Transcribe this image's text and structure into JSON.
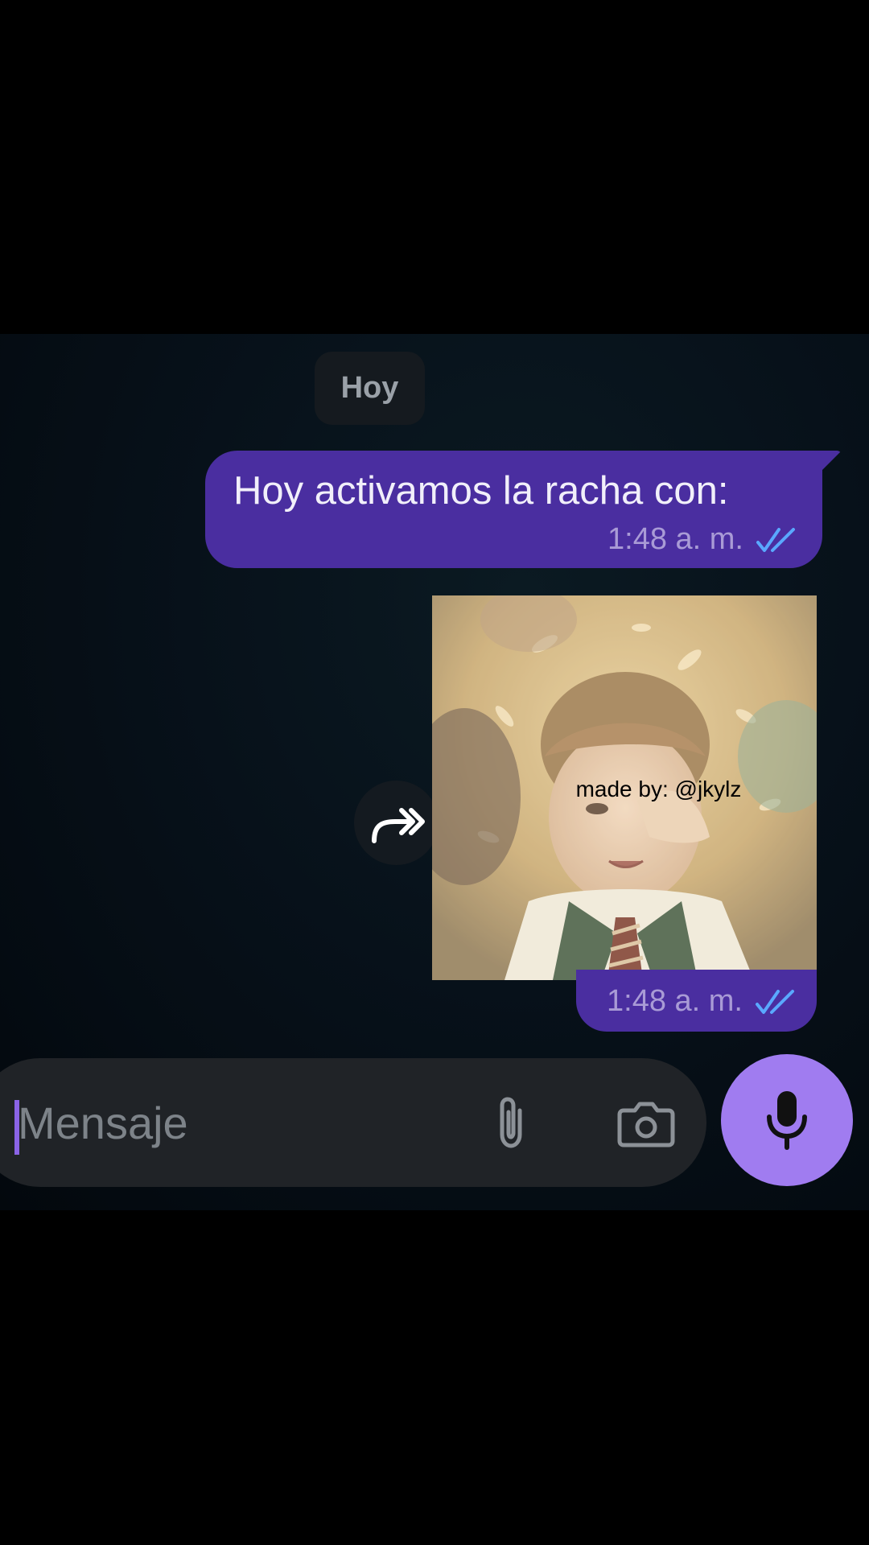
{
  "chat": {
    "date_label": "Hoy",
    "messages": [
      {
        "text": "Hoy activamos la racha con:",
        "time": "1:48 a. m.",
        "status_icon": "double-check-icon"
      },
      {
        "image_watermark": "made by: @jkylz",
        "time": "1:48 a. m.",
        "status_icon": "double-check-icon"
      }
    ],
    "forward_icon": "forward-arrow-icon"
  },
  "composer": {
    "placeholder": "Mensaje",
    "attach_icon": "paperclip-icon",
    "camera_icon": "camera-icon",
    "mic_icon": "microphone-icon"
  },
  "colors": {
    "bubble": "#4a2ea0",
    "accent": "#a07cf0",
    "check_blue": "#5aa8ff"
  }
}
